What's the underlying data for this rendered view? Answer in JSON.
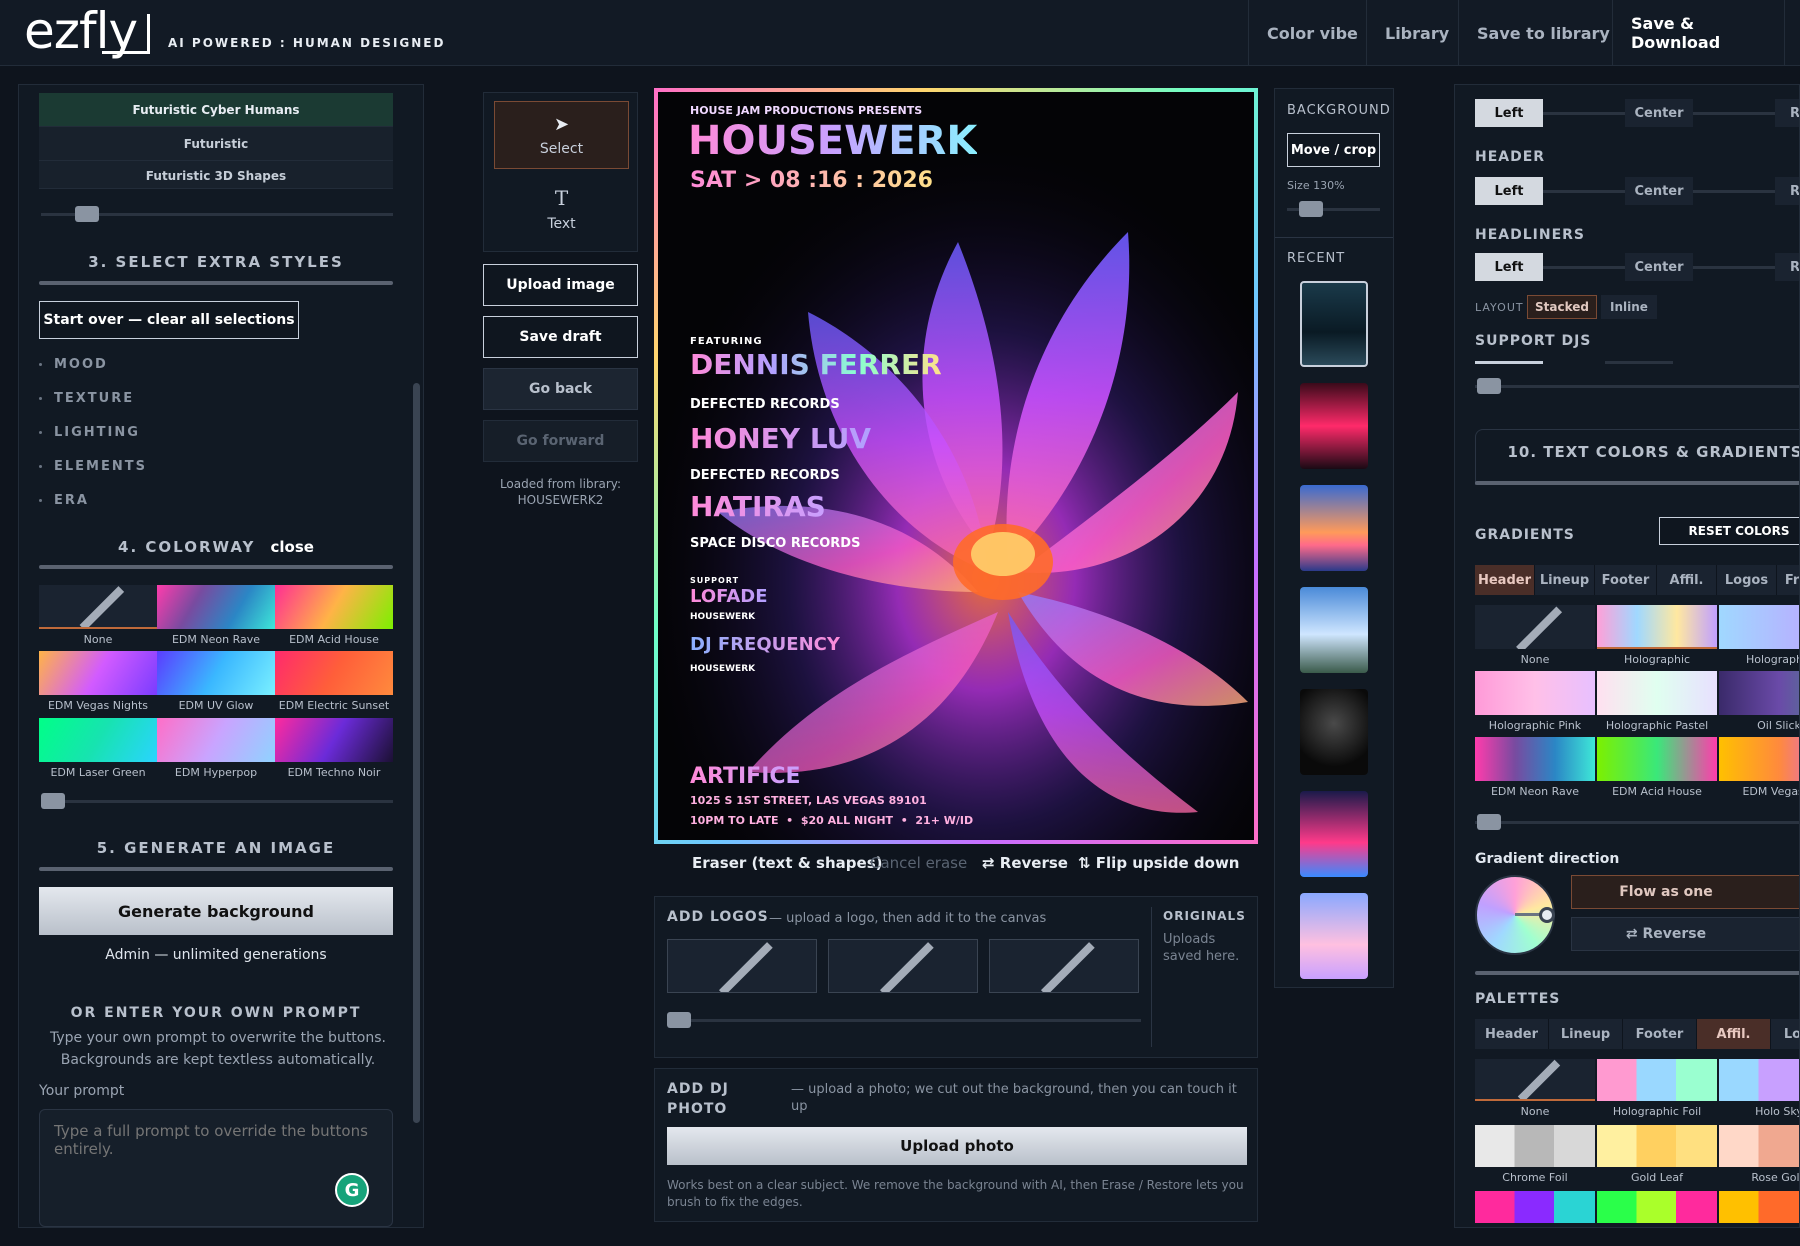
{
  "header": {
    "logo": "ezfly",
    "tagline": "AI POWERED : HUMAN DESIGNED",
    "nav": [
      "Color vibe",
      "Library",
      "Save to library",
      "Save & Download"
    ]
  },
  "left": {
    "styles": [
      "Futuristic Cyber Humans",
      "Futuristic",
      "Futuristic 3D Shapes"
    ],
    "section3": "3. SELECT EXTRA STYLES",
    "start_over": "Start over — clear all selections",
    "categories": [
      "MOOD",
      "TEXTURE",
      "LIGHTING",
      "ELEMENTS",
      "ERA"
    ],
    "section4": "4. COLORWAY",
    "section4_close": "close",
    "colorways": [
      "None",
      "EDM Neon Rave",
      "EDM Acid House",
      "EDM Vegas Nights",
      "EDM UV Glow",
      "EDM Electric Sunset",
      "EDM Laser Green",
      "EDM Hyperpop",
      "EDM Techno Noir"
    ],
    "section5": "5. GENERATE AN IMAGE",
    "generate": "Generate background",
    "admin": "Admin — unlimited generations",
    "own_prompt_title": "OR ENTER YOUR OWN PROMPT",
    "own_prompt_desc1": "Type your own prompt to overwrite the buttons.",
    "own_prompt_desc2": "Backgrounds are kept textless automatically.",
    "your_prompt": "Your prompt",
    "prompt_placeholder": "Type a full prompt to override the buttons entirely."
  },
  "tools": {
    "select": "Select",
    "text": "Text",
    "upload": "Upload image",
    "save_draft": "Save draft",
    "go_back": "Go back",
    "go_forward": "Go forward",
    "loaded_from": "Loaded from library:",
    "loaded_name": "HOUSEWERK2"
  },
  "poster": {
    "presents": "HOUSE JAM PRODUCTIONS PRESENTS",
    "title": "HOUSEWERK",
    "date": "SAT > 08 :16 : 2026",
    "featuring": "FEATURING",
    "dj1": "DENNIS FERRER",
    "dj1_label": "DEFECTED RECORDS",
    "dj2": "HONEY LUV",
    "dj2_label": "DEFECTED RECORDS",
    "dj3": "HATIRAS",
    "dj3_label": "SPACE DISCO RECORDS",
    "support": "SUPPORT",
    "sup1": "LOFADE",
    "sup1_label": "HOUSEWERK",
    "sup2": "DJ FREQUENCY",
    "sup2_label": "HOUSEWERK",
    "venue": "ARTIFICE",
    "address": "1025 S 1ST STREET, LAS VEGAS 89101",
    "details": "10PM TO LATE  •  $20 ALL NIGHT  •  21+ W/ID"
  },
  "canvas_tools": {
    "eraser": "Eraser (text & shapes)",
    "cancel": "Cancel erase",
    "reverse": "⇄ Reverse",
    "flip": "⇅ Flip upside down"
  },
  "logos": {
    "title": "ADD LOGOS",
    "desc": "— upload a logo, then add it to the canvas",
    "originals": "ORIGINALS",
    "originals_desc1": "Uploads",
    "originals_desc2": "saved here."
  },
  "dj_photo": {
    "title1": "ADD DJ",
    "title2": "PHOTO",
    "desc": "— upload a photo; we cut out the background, then you can touch it up",
    "button": "Upload photo",
    "note1": "Works best on a clear subject. We remove the background with AI, then Erase / Restore lets you",
    "note2": "brush to fix the edges."
  },
  "background": {
    "title": "BACKGROUND",
    "move_crop": "Move / crop",
    "size": "Size 130%",
    "recent": "RECENT"
  },
  "right": {
    "align_left": "Left",
    "align_center": "Center",
    "align_right": "R",
    "header_label": "HEADER",
    "headliners_label": "HEADLINERS",
    "layout_label": "LAYOUT",
    "layout_stacked": "Stacked",
    "layout_inline": "Inline",
    "support_label": "SUPPORT DJS",
    "section10": "10. TEXT COLORS & GRADIENTS",
    "gradients": "GRADIENTS",
    "reset": "RESET COLORS",
    "grad_tabs": [
      "Header",
      "Lineup",
      "Footer",
      "Affil.",
      "Logos",
      "Fra"
    ],
    "grad_swatches": [
      "None",
      "Holographic",
      "Holographic",
      "Holographic Pink",
      "Holographic Pastel",
      "Oil Slick",
      "EDM Neon Rave",
      "EDM Acid House",
      "EDM Vegas N"
    ],
    "direction": "Gradient direction",
    "flow": "Flow as one",
    "reverse": "⇄ Reverse",
    "palettes": "PALETTES",
    "pal_tabs": [
      "Header",
      "Lineup",
      "Footer",
      "Affil.",
      "Lo"
    ],
    "pal_swatches": [
      "None",
      "Holographic Foil",
      "Holo Sky",
      "Chrome Foil",
      "Gold Leaf",
      "Rose Gold"
    ]
  }
}
